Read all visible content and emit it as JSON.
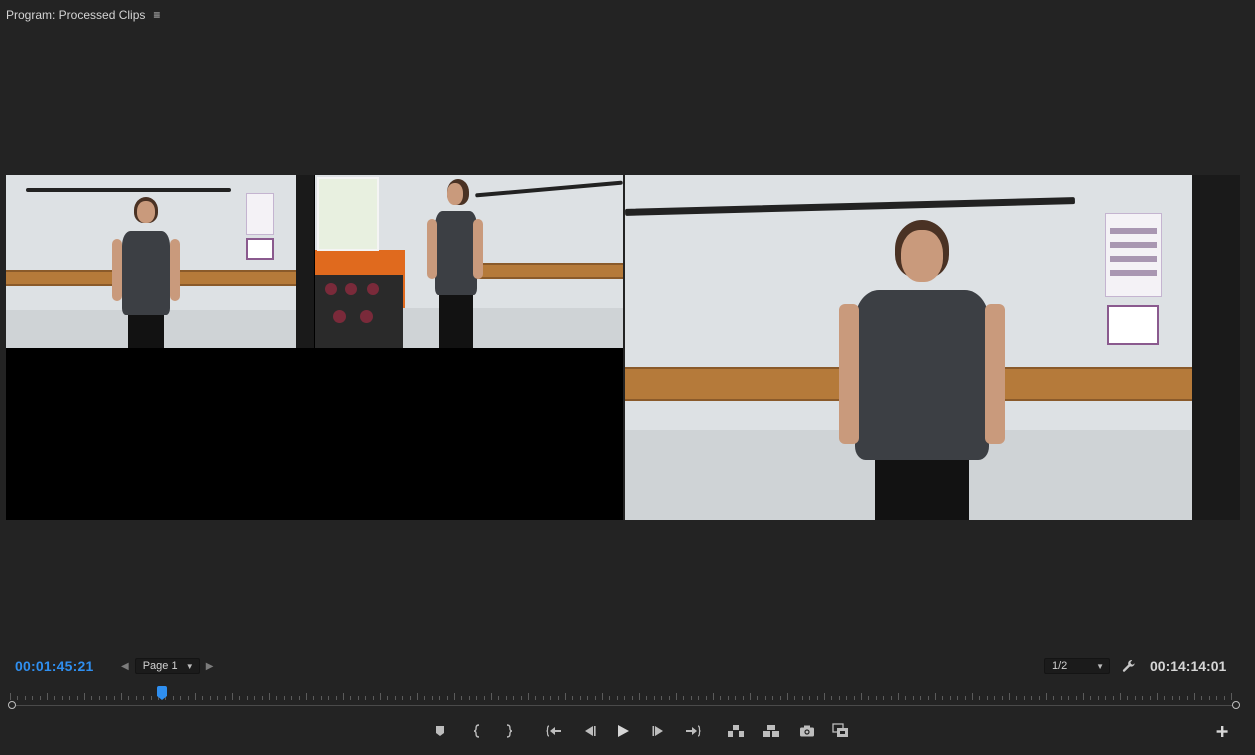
{
  "panel": {
    "title": "Program: Processed Clips",
    "menu_icon": "hamburger-menu-icon"
  },
  "viewer": {
    "mode": "multi-camera",
    "selected_angle": 1,
    "angle_highlight_color": "#e8e02a"
  },
  "controls": {
    "current_timecode": "00:01:45:21",
    "page_select": {
      "selected": "Page 1"
    },
    "resolution_select": {
      "selected": "1/2"
    },
    "duration_timecode": "00:14:14:01",
    "timecode_color": "#2f8ff0",
    "playhead_fraction": 0.125
  },
  "transport_buttons": [
    {
      "name": "add-marker-icon"
    },
    {
      "name": "mark-in-icon"
    },
    {
      "name": "mark-out-icon"
    },
    {
      "name": "go-to-in-icon"
    },
    {
      "name": "step-back-icon"
    },
    {
      "name": "play-icon"
    },
    {
      "name": "step-forward-icon"
    },
    {
      "name": "go-to-out-icon"
    },
    {
      "name": "lift-icon"
    },
    {
      "name": "extract-icon"
    },
    {
      "name": "export-frame-icon"
    },
    {
      "name": "toggle-multicam-icon"
    }
  ],
  "add_button_icon": "plus-icon"
}
